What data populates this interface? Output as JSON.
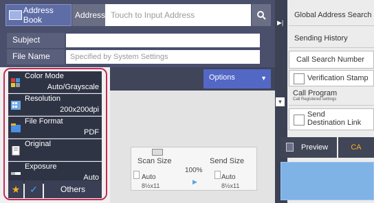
{
  "header": {
    "address_book": "Address Book",
    "address_label": "Address",
    "address_placeholder": "Touch to Input Address"
  },
  "fields": {
    "subject_label": "Subject",
    "subject_value": "",
    "file_name_label": "File Name",
    "file_name_placeholder": "Specified by System Settings"
  },
  "settings": [
    {
      "title": "Color Mode",
      "value": "Auto/Grayscale",
      "icon": "color-mode-icon"
    },
    {
      "title": "Resolution",
      "value": "200x200dpi",
      "icon": "resolution-icon"
    },
    {
      "title": "File Format",
      "value": "PDF",
      "icon": "file-format-icon"
    },
    {
      "title": "Original",
      "value": "",
      "icon": "original-icon"
    },
    {
      "title": "Exposure",
      "value": "Auto",
      "icon": "exposure-icon"
    }
  ],
  "bottom_left": {
    "others": "Others"
  },
  "options": {
    "label": "Options"
  },
  "size": {
    "scan_label": "Scan Size",
    "send_label": "Send Size",
    "ratio": "100%",
    "scan_value": "Auto",
    "send_value": "Auto",
    "scan_paper": "8½x11",
    "send_paper": "8½x11"
  },
  "right_panel": {
    "global_search": "Global Address Search",
    "sending_history": "Sending History",
    "call_search": "Call Search Number",
    "verification_stamp": "Verification Stamp",
    "call_program": "Call Program",
    "call_program_sub": "Call Registered settings",
    "send_destination_link_1": "Send",
    "send_destination_link_2": "Destination Link",
    "preview": "Preview",
    "ca": "CA"
  },
  "colors": {
    "accent": "#5367c5",
    "highlight": "#c32a53",
    "dark": "#2f3445"
  }
}
